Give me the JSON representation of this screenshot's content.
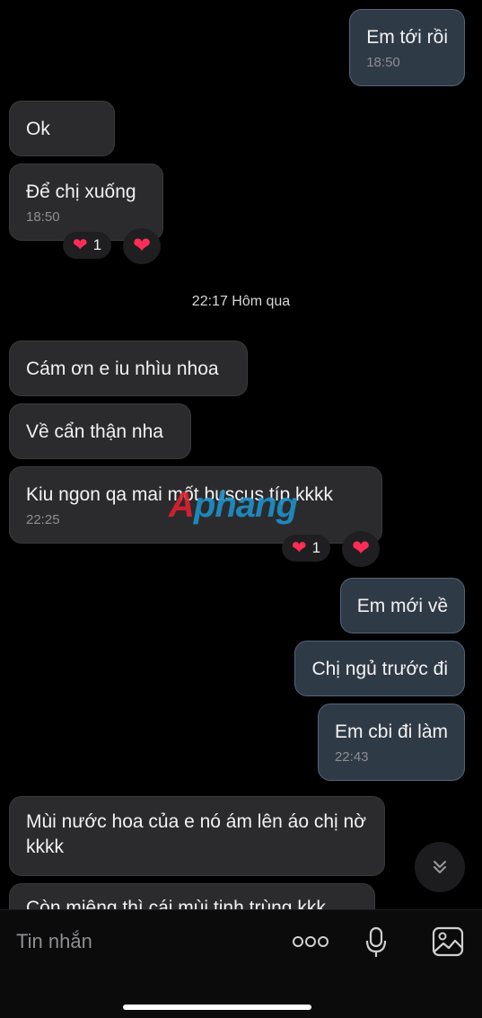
{
  "messages": [
    {
      "text": "Em tới rồi",
      "time": "18:50"
    },
    {
      "text": "Ok"
    },
    {
      "text": "Để chị xuống",
      "time": "18:50",
      "reactions": {
        "count": "1"
      }
    },
    {
      "text": "Cám ơn e iu nhìu nhoa"
    },
    {
      "text": "Về cẩn thận nha"
    },
    {
      "text": "Kiu ngon qa mai mốt buscus típ kkkk",
      "time": "22:25",
      "reactions": {
        "count": "1"
      }
    },
    {
      "text": "Em mới về"
    },
    {
      "text": "Chị ngủ trước đi"
    },
    {
      "text": "Em cbi đi làm",
      "time": "22:43"
    },
    {
      "text": "Mùi nước hoa của e nó ám lên áo chị nờ kkkk"
    },
    {
      "text": "Còn miệng thì cái mùi tinh trùng kkk"
    }
  ],
  "date_separator": "22:17 Hôm qua",
  "watermark": {
    "part1": "A",
    "part2": "phang"
  },
  "composer": {
    "placeholder": "Tin nhắn"
  },
  "colors": {
    "incoming": "#2b2b2d",
    "outgoing": "#2f3a47",
    "heart": "#ff2d55"
  },
  "icons": [
    "chevron-down-icon",
    "more-icon",
    "microphone-icon",
    "image-icon",
    "heart-icon"
  ]
}
